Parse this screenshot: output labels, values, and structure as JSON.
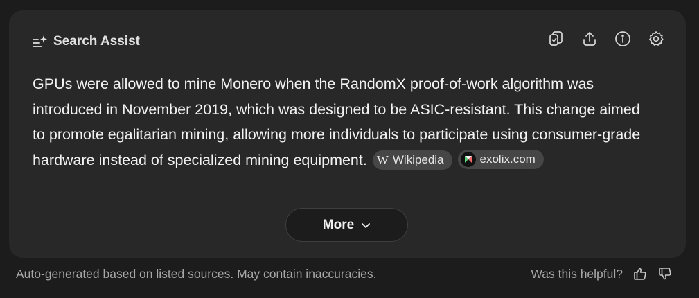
{
  "header": {
    "title": "Search Assist",
    "icon": "sparkle-list-icon",
    "actions": [
      {
        "name": "copy-button",
        "icon": "copy-icon"
      },
      {
        "name": "share-button",
        "icon": "share-icon"
      },
      {
        "name": "info-button",
        "icon": "info-icon"
      },
      {
        "name": "settings-button",
        "icon": "gear-icon"
      }
    ]
  },
  "answer": {
    "text": "GPUs were allowed to mine Monero when the RandomX proof-of-work algorithm was introduced in November 2019, which was designed to be ASIC-resistant. This change aimed to promote egalitarian mining, allowing more individuals to participate using consumer-grade hardware instead of specialized mining equipment.",
    "sources": [
      {
        "logo": "W",
        "label": "Wikipedia"
      },
      {
        "logo": "exolix-logo-icon",
        "label": "exolix.com"
      }
    ]
  },
  "more_button": {
    "label": "More",
    "icon": "chevron-down-icon"
  },
  "footer": {
    "note": "Auto-generated based on listed sources. May contain inaccuracies.",
    "feedback_prompt": "Was this helpful?"
  },
  "colors": {
    "page_bg": "#1c1c1c",
    "card_bg": "#282828",
    "chip_bg": "#464646",
    "text": "#f2f2f2",
    "muted": "#a7a7a7"
  }
}
